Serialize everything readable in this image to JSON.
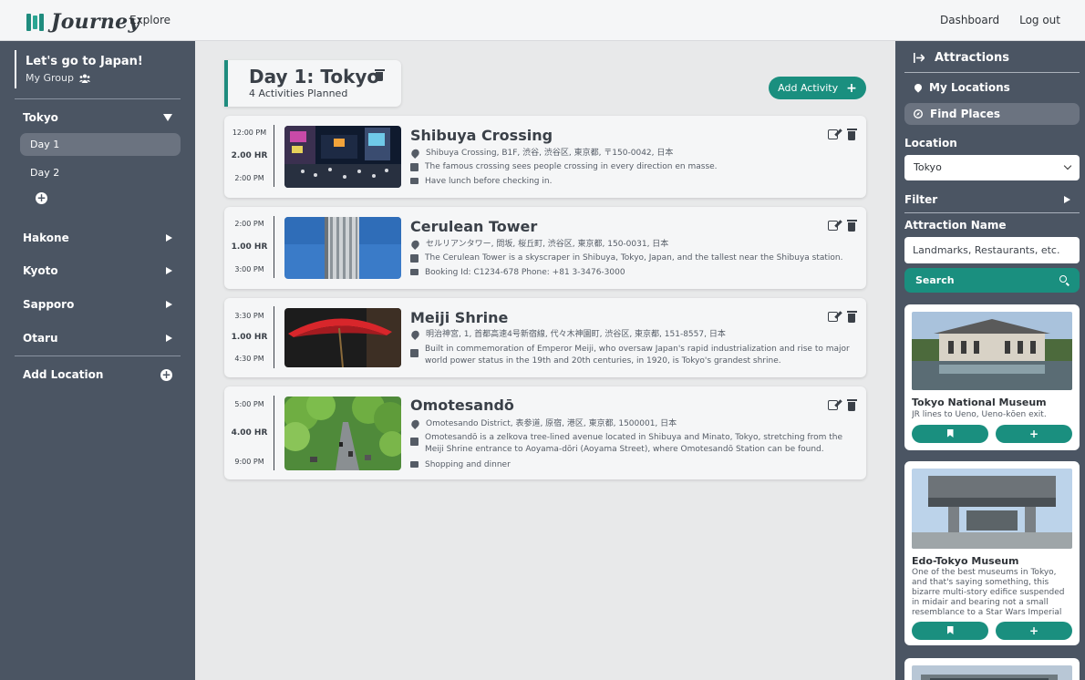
{
  "brand": {
    "name": "Journey",
    "accent": "#1a8f7f",
    "sidebar_bg": "#4b5563"
  },
  "topnav": {
    "explore": "Explore",
    "dashboard": "Dashboard",
    "logout": "Log out"
  },
  "trip": {
    "title": "Let's go to Japan!",
    "group": "My Group",
    "group_icon": "group-icon"
  },
  "sidebar": {
    "locations": [
      {
        "name": "Tokyo",
        "expanded": true
      },
      {
        "name": "Hakone",
        "expanded": false
      },
      {
        "name": "Kyoto",
        "expanded": false
      },
      {
        "name": "Sapporo",
        "expanded": false
      },
      {
        "name": "Otaru",
        "expanded": false
      }
    ],
    "days": [
      "Day 1",
      "Day 2"
    ],
    "active_day": "Day 1",
    "add_location": "Add Location"
  },
  "main": {
    "day_title": "Day 1: Tokyo",
    "day_subtitle": "4 Activities Planned",
    "add_activity": "Add Activity",
    "activities": [
      {
        "start": "12:00 PM",
        "duration": "2.00 HR",
        "end": "2:00 PM",
        "title": "Shibuya Crossing",
        "address": "Shibuya Crossing, B1F, 渋谷, 渋谷区, 東京都, 〒150-0042, 日本",
        "description": "The famous crossing sees people crossing in every direction en masse.",
        "note": "Have lunch before checking in."
      },
      {
        "start": "2:00 PM",
        "duration": "1.00 HR",
        "end": "3:00 PM",
        "title": "Cerulean Tower",
        "address": "セルリアンタワー, 問坂, 桜丘町, 渋谷区, 東京都, 150-0031, 日本",
        "description": "The Cerulean Tower is a skyscraper in Shibuya, Tokyo, Japan, and the tallest near the Shibuya station.",
        "note": "Booking Id: C1234-678 Phone: +81 3-3476-3000"
      },
      {
        "start": "3:30 PM",
        "duration": "1.00 HR",
        "end": "4:30 PM",
        "title": "Meiji Shrine",
        "address": "明治神宮, 1, 首都高速4号新宿線, 代々木神園町, 渋谷区, 東京都, 151-8557, 日本",
        "description": "Built in commemoration of Emperor Meiji, who oversaw Japan's rapid industrialization and rise to major world power status in the 19th and 20th centuries, in 1920, is Tokyo's grandest shrine.",
        "note": ""
      },
      {
        "start": "5:00 PM",
        "duration": "4.00 HR",
        "end": "9:00 PM",
        "title": "Omotesandō",
        "address": "Omotesando District, 表参道, 原宿, 港区, 東京都, 1500001, 日本",
        "description": "Omotesandō is a zelkova tree-lined avenue located in Shibuya and Minato, Tokyo, stretching from the Meiji Shrine entrance to Aoyama-dōri (Aoyama Street), where Omotesandō Station can be found.",
        "note": "Shopping and dinner"
      }
    ]
  },
  "panel": {
    "header": "Attractions",
    "my_locations": "My Locations",
    "find_places": "Find Places",
    "location_label": "Location",
    "location_value": "Tokyo",
    "filter_label": "Filter",
    "attraction_name_label": "Attraction Name",
    "attraction_placeholder": "Landmarks, Restaurants, etc.",
    "search_label": "Search",
    "results": [
      {
        "name": "Tokyo National Museum",
        "description": "JR lines to Ueno, Ueno-kōen exit."
      },
      {
        "name": "Edo-Tokyo Museum",
        "description": "One of the best museums in Tokyo, and that's saying something, this bizarre multi-story edifice suspended in midair and bearing not a small resemblance to a Star Wars Imperial Walker (meant to..."
      }
    ],
    "add_symbol": "+"
  }
}
